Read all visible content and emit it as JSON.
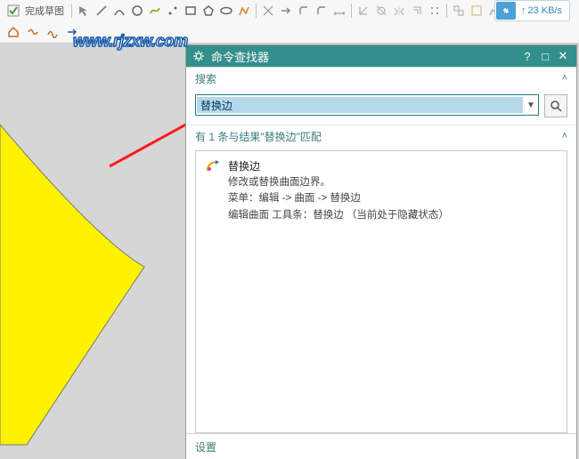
{
  "toolbar": {
    "sketch_done_label": "完成草图"
  },
  "speed": {
    "value": "23 KB/s"
  },
  "watermark": "www.rjzxw.com",
  "panel": {
    "title": "命令查找器",
    "search_label": "搜索",
    "search_value": "替换边",
    "results_label": "有 1 条与结果\"替换边\"匹配",
    "settings_label": "设置",
    "result": {
      "title": "替换边",
      "desc": "修改或替换曲面边界。",
      "menu": "菜单：编辑 -> 曲面 -> 替换边",
      "toolbar": "编辑曲面 工具条：替换边 （当前处于隐藏状态）"
    }
  }
}
